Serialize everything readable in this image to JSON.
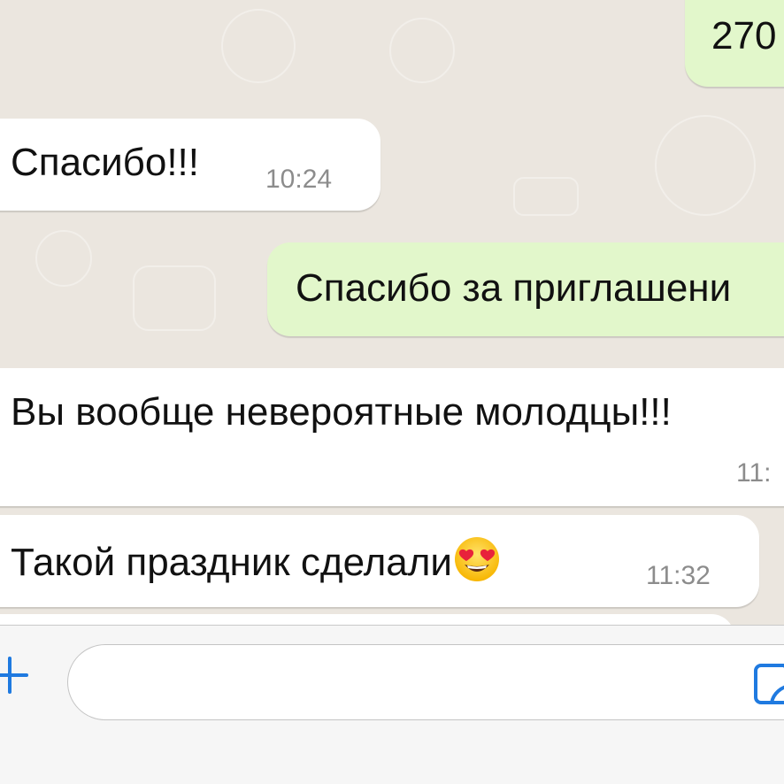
{
  "messages": [
    {
      "direction": "outgoing",
      "text": "270",
      "time": ""
    },
    {
      "direction": "incoming",
      "text": "Спасибо!!!",
      "time": "10:24"
    },
    {
      "direction": "outgoing",
      "text": "Спасибо за приглашени",
      "time": ""
    },
    {
      "direction": "incoming",
      "text": "Вы вообще невероятные молодцы!!!",
      "time": "11:"
    },
    {
      "direction": "incoming",
      "text": "Такой праздник сделали",
      "emoji": "smiling-face-with-heart-eyes",
      "time": "11:32"
    }
  ],
  "composer": {
    "input_value": "",
    "plus_icon": "plus-icon",
    "sticker_icon": "sticker-icon"
  },
  "colors": {
    "chat_background": "#ebe6df",
    "incoming_bubble": "#ffffff",
    "outgoing_bubble": "#e2f7cb",
    "accent": "#1f7ae0",
    "timestamp": "#8c8c8c"
  }
}
